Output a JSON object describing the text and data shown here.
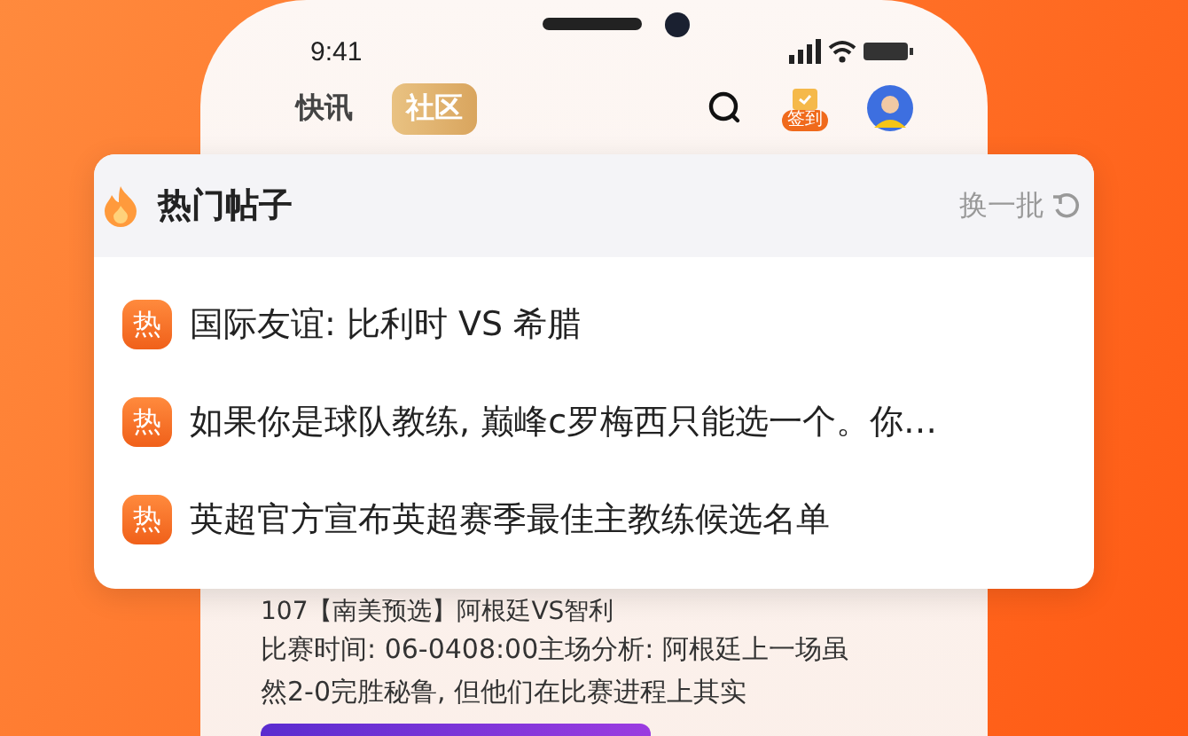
{
  "status_bar": {
    "time": "9:41"
  },
  "tabs": [
    {
      "label": "快讯",
      "selected": false
    },
    {
      "label": "社区",
      "selected": true
    }
  ],
  "checkin_badge": "签到",
  "post": {
    "title": "107【南美预选】阿根廷VS智利",
    "body": "比赛时间: 06-0408:00主场分析: 阿根廷上一场虽然2-0完胜秘鲁, 但他们在比赛进程上其实"
  },
  "hot_posts": {
    "title": "热门帖子",
    "refresh": "换一批",
    "items": [
      {
        "badge": "热",
        "text": "国际友谊: 比利时 VS 希腊"
      },
      {
        "badge": "热",
        "text": "如果你是球队教练, 巅峰c罗梅西只能选一个。你…"
      },
      {
        "badge": "热",
        "text": "英超官方宣布英超赛季最佳主教练候选名单"
      }
    ]
  }
}
